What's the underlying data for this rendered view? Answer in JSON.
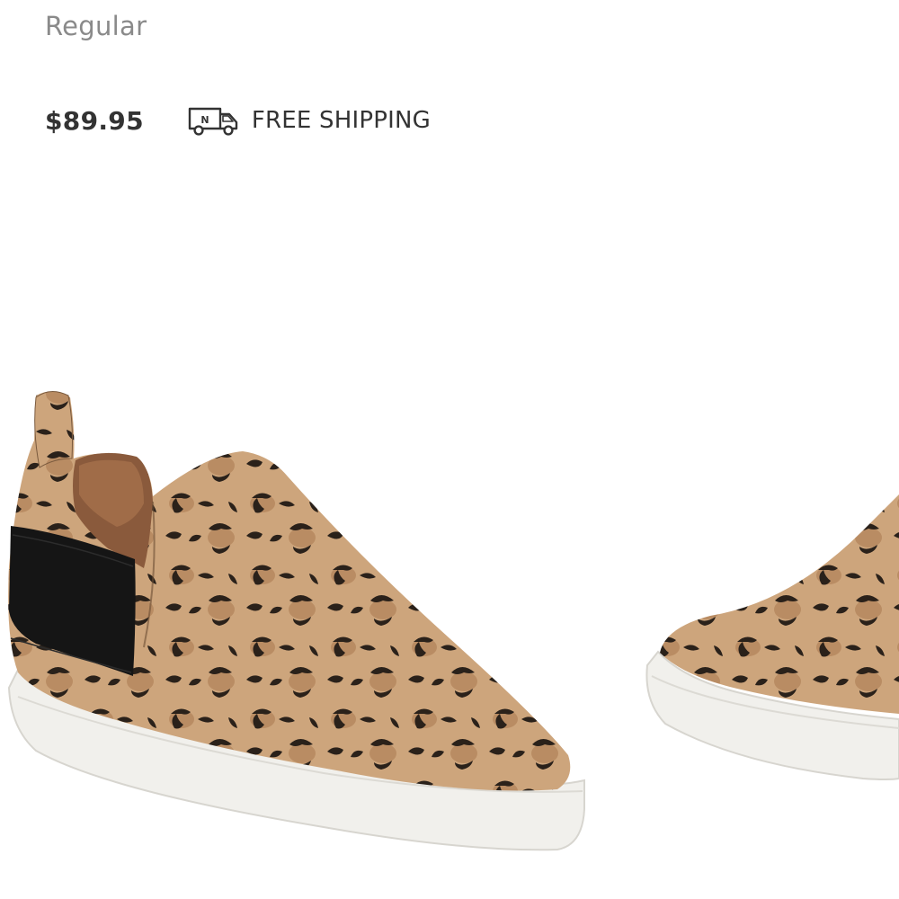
{
  "product": {
    "width_label": "Regular",
    "price": "$89.95",
    "shipping": {
      "icon": "truck-icon",
      "label": "FREE SHIPPING"
    },
    "image": {
      "alt": "Leopard print slip-on wedge sneaker",
      "print_color": "#c9a27a",
      "spot_color": "#2a211a",
      "sole_color": "#f1f0ec",
      "elastic_color": "#151515"
    }
  },
  "colors": {
    "muted_text": "#8a8a8a",
    "primary_text": "#333333",
    "background": "#ffffff"
  }
}
